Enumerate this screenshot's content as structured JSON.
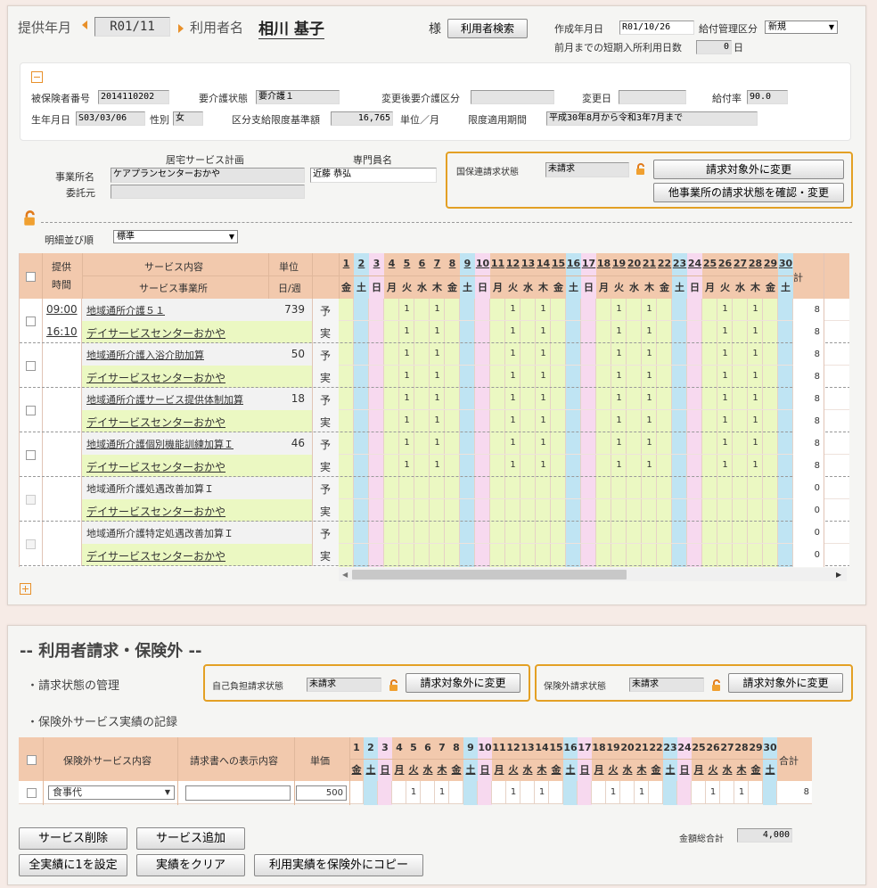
{
  "header": {
    "provide_month_label": "提供年月",
    "provide_month": "R01/11",
    "user_name_label": "利用者名",
    "user_name": "相川 基子",
    "honorific": "様",
    "user_search_btn": "利用者検索",
    "created_label": "作成年月日",
    "created_value": "R01/10/26",
    "pay_class_label": "給付管理区分",
    "pay_class_value": "新規",
    "prev_days_label": "前月までの短期入所利用日数",
    "prev_days_value": "0",
    "prev_days_unit": "日"
  },
  "info": {
    "insured_no_label": "被保険者番号",
    "insured_no": "2014110202",
    "care_level_label": "要介護状態",
    "care_level": "要介護１",
    "changed_level_label": "変更後要介護区分",
    "changed_level": "",
    "change_date_label": "変更日",
    "change_date": "",
    "pay_rate_label": "給付率",
    "pay_rate": "90.0",
    "birth_label": "生年月日",
    "birth": "S03/03/06",
    "sex_label": "性別",
    "sex": "女",
    "limit_label": "区分支給限度基準額",
    "limit_value": "16,765",
    "unit_label": "単位／月",
    "period_label": "限度適用期間",
    "period_value": "平成30年8月から令和3年7月まで"
  },
  "plan": {
    "section_title": "居宅サービス計画",
    "specialist_title": "専門員名",
    "office_label": "事業所名",
    "office_value": "ケアプランセンターおかや",
    "specialist_value": "近藤 恭弘",
    "consign_label": "委託元",
    "consign_value": ""
  },
  "nhi": {
    "status_label": "国保連請求状態",
    "status_value": "未請求",
    "btn_exclude": "請求対象外に変更",
    "btn_check": "他事業所の請求状態を確認・変更"
  },
  "sort": {
    "label": "明細並び順",
    "value": "標準"
  },
  "grid": {
    "h_time_1": "提供",
    "h_time_2": "時間",
    "h_service": "サービス内容",
    "h_office": "サービス事業所",
    "h_unit": "単位",
    "h_perweek": "日/週",
    "h_total": "合計",
    "days": [
      "1",
      "2",
      "3",
      "4",
      "5",
      "6",
      "7",
      "8",
      "9",
      "10",
      "11",
      "12",
      "13",
      "14",
      "15",
      "16",
      "17",
      "18",
      "19",
      "20",
      "21",
      "22",
      "23",
      "24",
      "25",
      "26",
      "27",
      "28",
      "29",
      "30"
    ],
    "weekdays": [
      "金",
      "土",
      "日",
      "月",
      "火",
      "水",
      "木",
      "金",
      "土",
      "日",
      "月",
      "火",
      "水",
      "木",
      "金",
      "土",
      "日",
      "月",
      "火",
      "水",
      "木",
      "金",
      "土",
      "日",
      "月",
      "火",
      "水",
      "木",
      "金",
      "土"
    ],
    "plan_label": "予",
    "actual_label": "実",
    "rows": [
      {
        "time_start": "09:00",
        "time_end": "16:10",
        "service": "地域通所介護５１",
        "office": "デイサービスセンターおかや",
        "unit": "739",
        "plan_total": "8",
        "actual_total": "8",
        "plan_days": [
          5,
          7,
          12,
          14,
          19,
          21,
          26,
          28
        ],
        "actual_days": [
          5,
          7,
          12,
          14,
          19,
          21,
          26,
          28
        ]
      },
      {
        "time_start": "",
        "time_end": "",
        "service": "地域通所介護入浴介助加算",
        "office": "デイサービスセンターおかや",
        "unit": "50",
        "plan_total": "8",
        "actual_total": "8",
        "plan_days": [
          5,
          7,
          12,
          14,
          19,
          21,
          26,
          28
        ],
        "actual_days": [
          5,
          7,
          12,
          14,
          19,
          21,
          26,
          28
        ]
      },
      {
        "time_start": "",
        "time_end": "",
        "service": "地域通所介護サービス提供体制加算",
        "office": "デイサービスセンターおかや",
        "unit": "18",
        "plan_total": "8",
        "actual_total": "8",
        "plan_days": [
          5,
          7,
          12,
          14,
          19,
          21,
          26,
          28
        ],
        "actual_days": [
          5,
          7,
          12,
          14,
          19,
          21,
          26,
          28
        ]
      },
      {
        "time_start": "",
        "time_end": "",
        "service": "地域通所介護個別機能訓練加算Ｉ",
        "office": "デイサービスセンターおかや",
        "unit": "46",
        "plan_total": "8",
        "actual_total": "8",
        "plan_days": [
          5,
          7,
          12,
          14,
          19,
          21,
          26,
          28
        ],
        "actual_days": [
          5,
          7,
          12,
          14,
          19,
          21,
          26,
          28
        ]
      },
      {
        "time_start": "",
        "time_end": "",
        "service": "地域通所介護処遇改善加算Ｉ",
        "office": "デイサービスセンターおかや",
        "unit": "",
        "plan_total": "0",
        "actual_total": "0",
        "plan_days": [],
        "actual_days": []
      },
      {
        "time_start": "",
        "time_end": "",
        "service": "地域通所介護特定処遇改善加算Ｉ",
        "office": "デイサービスセンターおかや",
        "unit": "",
        "plan_total": "0",
        "actual_total": "0",
        "plan_days": [],
        "actual_days": []
      }
    ]
  },
  "user_billing": {
    "title": "-- 利用者請求・保険外 --",
    "status_section": "・請求状態の管理",
    "self_label": "自己負担請求状態",
    "self_value": "未請求",
    "self_btn": "請求対象外に変更",
    "ext_label": "保険外請求状態",
    "ext_value": "未請求",
    "ext_btn": "請求対象外に変更",
    "record_section": "・保険外サービス実績の記録",
    "h_service": "保険外サービス内容",
    "h_display": "請求書への表示内容",
    "h_price": "単価",
    "h_total": "合計",
    "row_service": "食事代",
    "row_display": "",
    "row_price": "500",
    "row_total": "8",
    "row_days": [
      5,
      7,
      12,
      14,
      19,
      21,
      26,
      28
    ],
    "btn_delete": "サービス削除",
    "btn_add": "サービス追加",
    "btn_set1": "全実績に1を設定",
    "btn_clear": "実績をクリア",
    "btn_copy": "利用実績を保険外にコピー",
    "amount_label": "金額総合計",
    "amount_value": "4,000"
  },
  "colors": {
    "saturday": "#bfe4f3",
    "sunday": "#f7d9ef",
    "highlight": "#ebf8c2",
    "accent": "#e3a024",
    "header": "#f2c9ad"
  }
}
